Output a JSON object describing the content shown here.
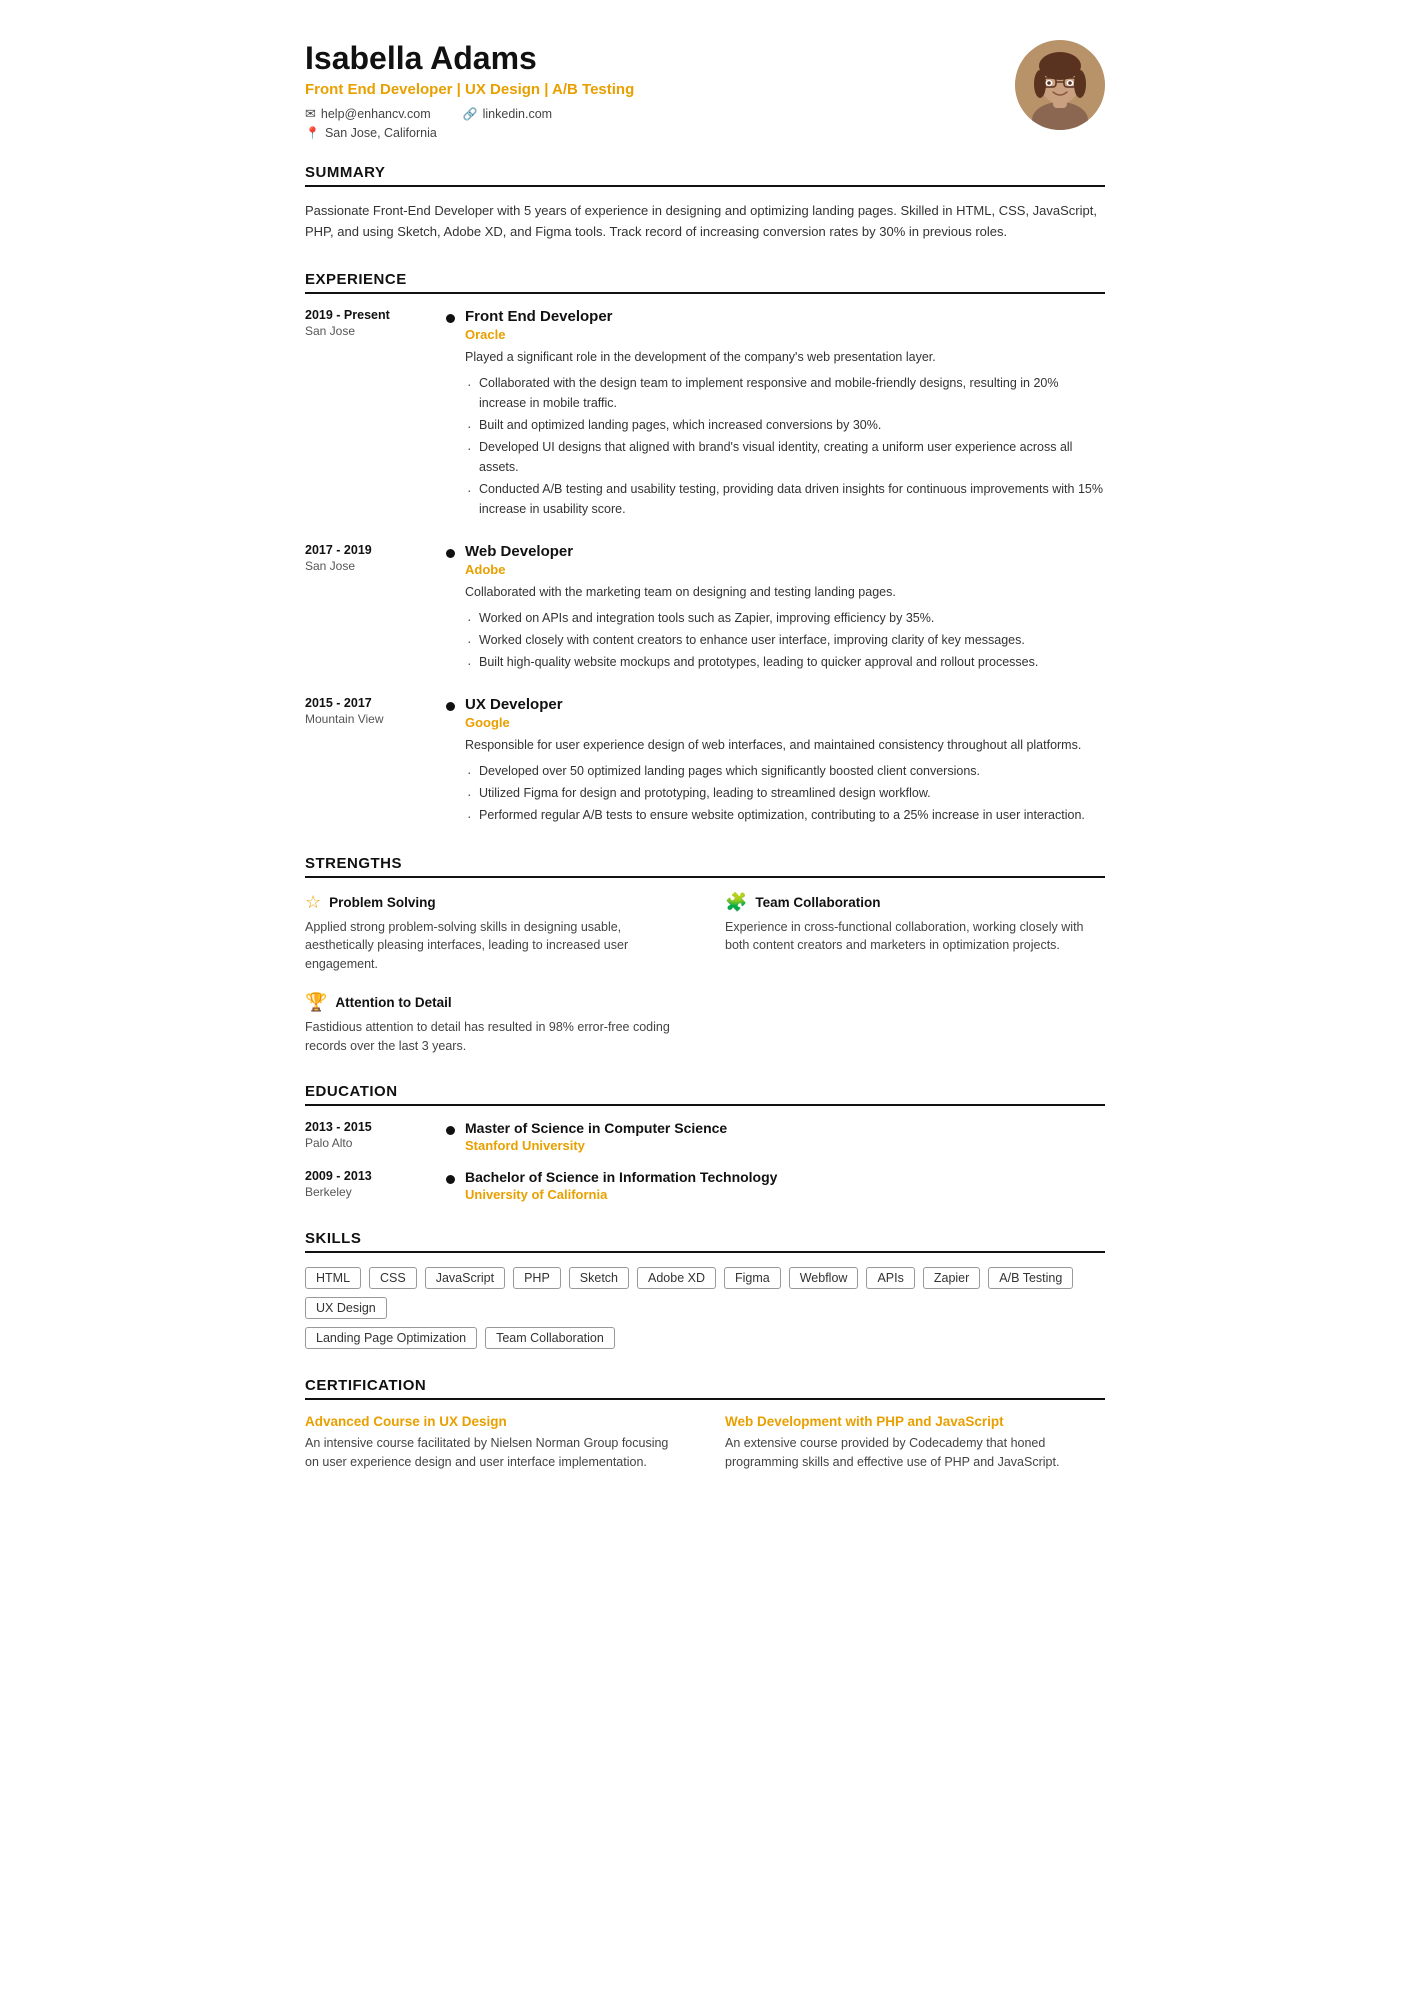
{
  "header": {
    "name": "Isabella Adams",
    "title": "Front End Developer | UX Design | A/B Testing",
    "email": "help@enhancv.com",
    "linkedin": "linkedin.com",
    "location": "San Jose, California"
  },
  "summary": {
    "title": "SUMMARY",
    "text": "Passionate Front-End Developer with 5 years of experience in designing and optimizing landing pages. Skilled in HTML, CSS, JavaScript, PHP, and using Sketch, Adobe XD, and Figma tools. Track record of increasing conversion rates by 30% in previous roles."
  },
  "experience": {
    "title": "EXPERIENCE",
    "items": [
      {
        "dateRange": "2019 - Present",
        "location": "San Jose",
        "jobTitle": "Front End Developer",
        "company": "Oracle",
        "description": "Played a significant role in the development of the company's web presentation layer.",
        "bullets": [
          "Collaborated with the design team to implement responsive and mobile-friendly designs, resulting in 20% increase in mobile traffic.",
          "Built and optimized landing pages, which increased conversions by 30%.",
          "Developed UI designs that aligned with brand's visual identity, creating a uniform user experience across all assets.",
          "Conducted A/B testing and usability testing, providing data driven insights for continuous improvements with 15% increase in usability score."
        ]
      },
      {
        "dateRange": "2017 - 2019",
        "location": "San Jose",
        "jobTitle": "Web Developer",
        "company": "Adobe",
        "description": "Collaborated with the marketing team on designing and testing landing pages.",
        "bullets": [
          "Worked on APIs and integration tools such as Zapier, improving efficiency by 35%.",
          "Worked closely with content creators to enhance user interface, improving clarity of key messages.",
          "Built high-quality website mockups and prototypes, leading to quicker approval and rollout processes."
        ]
      },
      {
        "dateRange": "2015 - 2017",
        "location": "Mountain View",
        "jobTitle": "UX Developer",
        "company": "Google",
        "description": "Responsible for user experience design of web interfaces, and maintained consistency throughout all platforms.",
        "bullets": [
          "Developed over 50 optimized landing pages which significantly boosted client conversions.",
          "Utilized Figma for design and prototyping, leading to streamlined design workflow.",
          "Performed regular A/B tests to ensure website optimization, contributing to a 25% increase in user interaction."
        ]
      }
    ]
  },
  "strengths": {
    "title": "STRENGTHS",
    "items": [
      {
        "icon": "☆",
        "title": "Problem Solving",
        "description": "Applied strong problem-solving skills in designing usable, aesthetically pleasing interfaces, leading to increased user engagement.",
        "col": 0
      },
      {
        "icon": "🧩",
        "title": "Team Collaboration",
        "description": "Experience in cross-functional collaboration, working closely with both content creators and marketers in optimization projects.",
        "col": 1
      },
      {
        "icon": "🏆",
        "title": "Attention to Detail",
        "description": "Fastidious attention to detail has resulted in 98% error-free coding records over the last 3 years.",
        "col": 0
      }
    ]
  },
  "education": {
    "title": "EDUCATION",
    "items": [
      {
        "dateRange": "2013 - 2015",
        "location": "Palo Alto",
        "degree": "Master of Science in Computer Science",
        "school": "Stanford University"
      },
      {
        "dateRange": "2009 - 2013",
        "location": "Berkeley",
        "degree": "Bachelor of Science in Information Technology",
        "school": "University of California"
      }
    ]
  },
  "skills": {
    "title": "SKILLS",
    "row1": [
      "HTML",
      "CSS",
      "JavaScript",
      "PHP",
      "Sketch",
      "Adobe XD",
      "Figma",
      "Webflow",
      "APIs",
      "Zapier",
      "A/B Testing",
      "UX Design"
    ],
    "row2": [
      "Landing Page Optimization",
      "Team Collaboration"
    ]
  },
  "certification": {
    "title": "CERTIFICATION",
    "items": [
      {
        "title": "Advanced Course in UX Design",
        "description": "An intensive course facilitated by Nielsen Norman Group focusing on user experience design and user interface implementation."
      },
      {
        "title": "Web Development with PHP and JavaScript",
        "description": "An extensive course provided by Codecademy that honed programming skills and effective use of PHP and JavaScript."
      }
    ]
  }
}
